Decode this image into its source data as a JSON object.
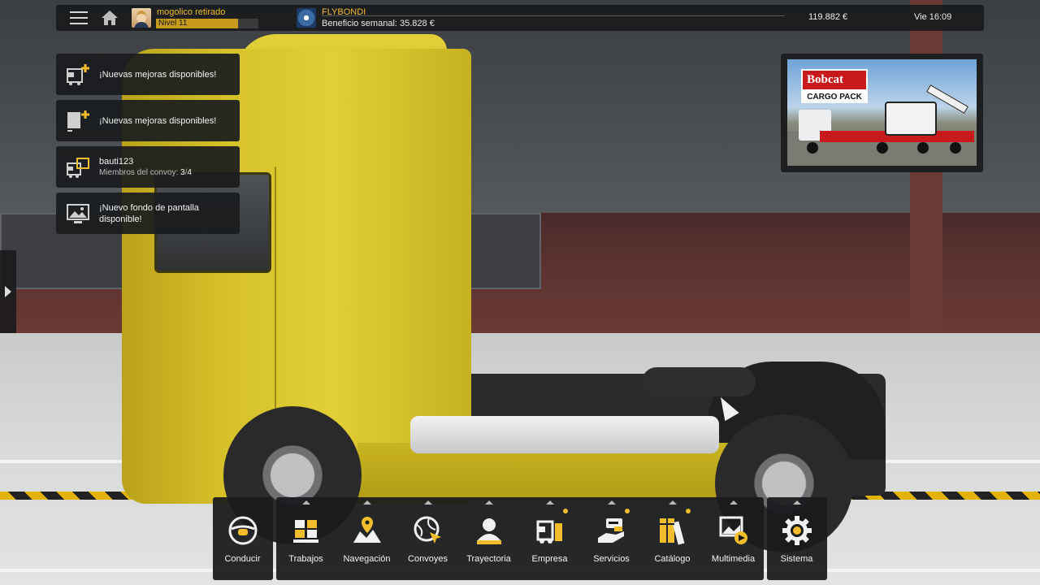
{
  "topbar": {
    "user_name": "mogolico retirado",
    "level_label": "Nivel 11",
    "level_progress": 0.8,
    "company_name": "FLYBONDI",
    "weekly_profit": "Beneficio semanal: 35.828 €",
    "money": "119.882 €",
    "datetime": "Vie 16:09"
  },
  "notifications": [
    {
      "text": "¡Nuevas mejoras disponibles!",
      "icon": "truck-plus-icon"
    },
    {
      "text": "¡Nuevas mejoras disponibles!",
      "icon": "trailer-plus-icon"
    },
    {
      "title": "bauti123",
      "subtitle_prefix": "Miembros del convoy: ",
      "members": "3",
      "members_sep": "/",
      "members_max": "4",
      "icon": "convoy-icon"
    },
    {
      "text_line1": "¡Nuevo fondo de pantalla",
      "text_line2": "disponible!",
      "icon": "wallpaper-icon"
    }
  ],
  "ad": {
    "brand": "Bobcat",
    "pack": "CARGO PACK"
  },
  "bottom_bar": {
    "drive": {
      "label": "Conducir",
      "icon": "steering-wheel-icon"
    },
    "items": [
      {
        "label": "Trabajos",
        "icon": "cargo-boxes-icon",
        "dot": false
      },
      {
        "label": "Navegación",
        "icon": "map-pin-icon",
        "dot": false
      },
      {
        "label": "Convoyes",
        "icon": "globe-cursor-icon",
        "dot": false
      },
      {
        "label": "Trayectoria",
        "icon": "profile-person-icon",
        "dot": false
      },
      {
        "label": "Empresa",
        "icon": "truck-building-icon",
        "dot": true
      },
      {
        "label": "Servicios",
        "icon": "services-hand-icon",
        "dot": true
      },
      {
        "label": "Catálogo",
        "icon": "books-icon",
        "dot": true
      },
      {
        "label": "Multimedia",
        "icon": "image-play-icon",
        "dot": false
      }
    ],
    "system": {
      "label": "Sistema",
      "icon": "gear-icon"
    }
  },
  "colors": {
    "accent": "#f1bd2a",
    "panel": "#191b1d",
    "truck": "#d6c12a"
  }
}
